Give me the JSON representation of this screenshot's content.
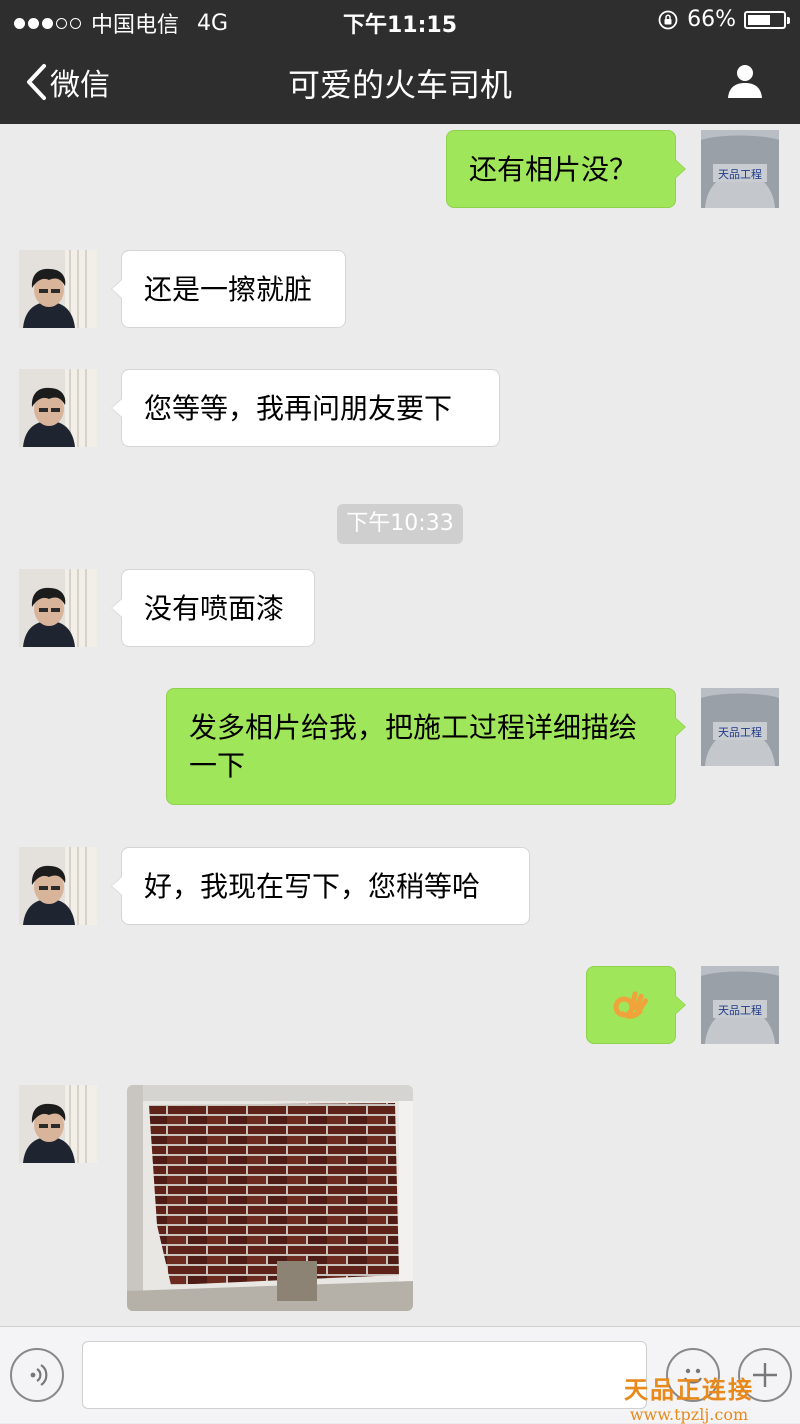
{
  "status_bar": {
    "carrier": "中国电信",
    "network": "4G",
    "time": "下午11:15",
    "battery_text": "66%",
    "battery_level": 0.66,
    "signal_bars": 3,
    "signal_total": 5
  },
  "nav": {
    "back_label": "微信",
    "title": "可爱的火车司机"
  },
  "messages": [
    {
      "side": "out",
      "text": "还有相片没？"
    },
    {
      "side": "in",
      "text": "还是一擦就脏"
    },
    {
      "side": "in",
      "text": "您等等，我再问朋友要下"
    },
    {
      "side": "in",
      "text": "没有喷面漆"
    },
    {
      "side": "out",
      "text": "发多相片给我，把施工过程详细描绘一下"
    },
    {
      "side": "in",
      "text": "好，我现在写下，您稍等哈"
    },
    {
      "side": "out",
      "emoji": "ok-hand-emoji"
    },
    {
      "side": "in",
      "image": "brick-wall-photo"
    }
  ],
  "timestamp_divider": "下午10:33",
  "self_avatar_shirt_text": "天品工程",
  "watermark": {
    "line1": "天品正连接",
    "line2": "www.tpzlj.com"
  },
  "colors": {
    "header_bg": "#2e2e2e",
    "chat_bg": "#ebebeb",
    "out_bubble": "#9fe65a",
    "in_bubble": "#ffffff",
    "watermark": "#e8891b"
  }
}
